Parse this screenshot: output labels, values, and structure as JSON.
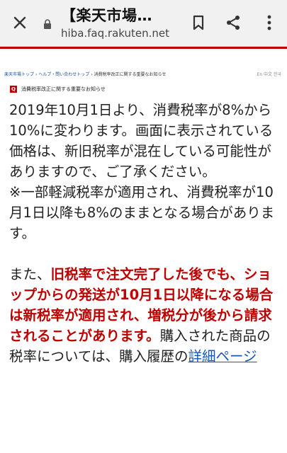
{
  "toolbar": {
    "title": "【楽天市場…",
    "url": "hiba.faq.rakuten.net",
    "icons": [
      "close-icon",
      "lock-icon",
      "bookmark-icon",
      "share-icon",
      "more-vert-icon"
    ]
  },
  "breadcrumb": {
    "items": [
      "楽天市場トップ",
      "ヘルプ・問い合わせトップ",
      "消費税率改正に関する重要なお知らせ"
    ]
  },
  "lang": "En 中文 한국",
  "notice": {
    "badge": "Q",
    "title": "消費税率改正に関する重要なお知らせ"
  },
  "body": {
    "p1": "2019年10月1日より、消費税率が8%から10%に変わります。画面に表示されている価格は、新旧税率が混在している可能性がありますので、ご了承ください。",
    "p2": "※一部軽減税率が適用され、消費税率が10月1日以降も8%のままとなる場合があります。",
    "p3_prefix": "また、",
    "p3_red": "旧税率で注文完了した後でも、ショップからの発送が10月1日以降になる場合は新税率が適用され、増税分が後から請求されることがあります。",
    "p3_suffix": "購入された商品の税率については、購入履歴の",
    "p3_link": "詳細ページ"
  },
  "colors": {
    "accent": "#bf0000",
    "link": "#1a55b6"
  }
}
